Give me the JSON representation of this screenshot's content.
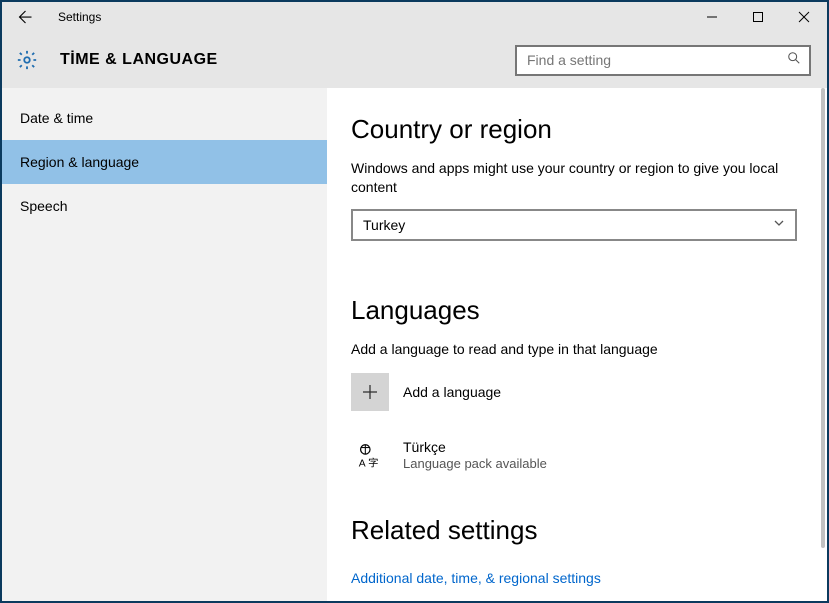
{
  "titlebar": {
    "app_name": "Settings"
  },
  "header": {
    "page_title": "TİME & LANGUAGE",
    "search_placeholder": "Find a setting"
  },
  "sidebar": {
    "items": [
      {
        "label": "Date & time"
      },
      {
        "label": "Region & language"
      },
      {
        "label": "Speech"
      }
    ],
    "active_index": 1
  },
  "main": {
    "section_country": {
      "heading": "Country or region",
      "description": "Windows and apps might use your country or region to give you local content",
      "selected": "Turkey"
    },
    "section_languages": {
      "heading": "Languages",
      "description": "Add a language to read and type in that language",
      "add_label": "Add a language",
      "items": [
        {
          "name": "Türkçe",
          "status": "Language pack available"
        }
      ]
    },
    "section_related": {
      "heading": "Related settings",
      "link": "Additional date, time, & regional settings"
    }
  }
}
